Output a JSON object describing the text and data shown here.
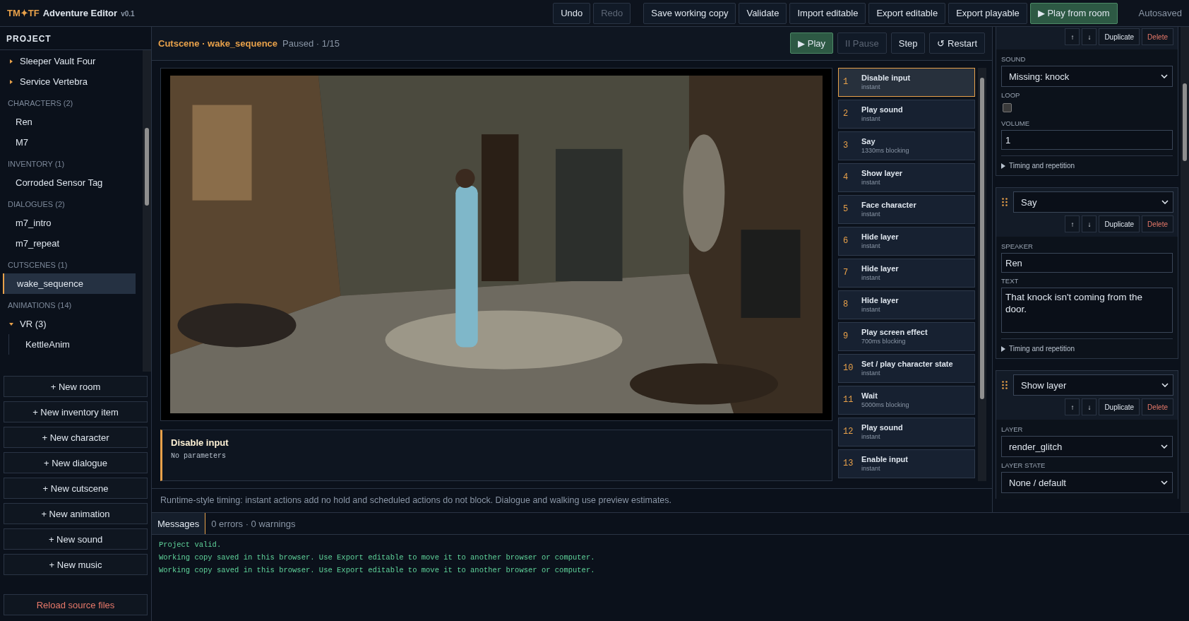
{
  "app": {
    "brand": "TM✦TF",
    "title": "Adventure Editor",
    "version": "v0.1",
    "status": "Autosaved"
  },
  "toolbar": [
    [
      {
        "label": "Undo",
        "kind": "plain",
        "disabled": false
      },
      {
        "label": "Redo",
        "kind": "plain",
        "disabled": true
      }
    ],
    [
      {
        "label": "Save working copy",
        "kind": "plain",
        "disabled": false
      },
      {
        "label": "Validate",
        "kind": "plain",
        "disabled": false
      },
      {
        "label": "Import editable",
        "kind": "plain",
        "disabled": false
      },
      {
        "label": "Export editable",
        "kind": "plain",
        "disabled": false
      },
      {
        "label": "Export playable",
        "kind": "plain",
        "disabled": false
      },
      {
        "label": "▶ Play from room",
        "kind": "primary",
        "disabled": false
      }
    ]
  ],
  "sidebar": {
    "heading": "PROJECT",
    "sections": [
      {
        "items": [
          {
            "label": "Sleeper Vault Four",
            "expanded": false,
            "selected": false
          },
          {
            "label": "Service Vertebra",
            "expanded": false,
            "selected": false
          }
        ]
      },
      {
        "heading": "CHARACTERS (2)",
        "items": [
          {
            "label": "Ren",
            "selected": false
          },
          {
            "label": "M7",
            "selected": false
          }
        ]
      },
      {
        "heading": "INVENTORY (1)",
        "items": [
          {
            "label": "Corroded Sensor Tag",
            "selected": false
          }
        ]
      },
      {
        "heading": "DIALOGUES (2)",
        "items": [
          {
            "label": "m7_intro",
            "selected": false
          },
          {
            "label": "m7_repeat",
            "selected": false
          }
        ]
      },
      {
        "heading": "CUTSCENES (1)",
        "items": [
          {
            "label": "wake_sequence",
            "selected": true
          }
        ]
      },
      {
        "heading": "ANIMATIONS (14)",
        "items": [
          {
            "label": "VR (3)",
            "expanded": true,
            "selected": false,
            "children": [
              {
                "label": "KettleAnim",
                "selected": false
              }
            ]
          }
        ]
      }
    ],
    "buttons": [
      "+ New room",
      "+ New inventory item",
      "+ New character",
      "+ New dialogue",
      "+ New cutscene",
      "+ New animation",
      "+ New sound",
      "+ New music"
    ],
    "reload": "Reload source files"
  },
  "cutscene": {
    "title": "Cutscene · wake_sequence",
    "status": "Paused · 1/15",
    "controls": [
      {
        "label": "▶ Play",
        "kind": "primary",
        "disabled": false
      },
      {
        "label": "II Pause",
        "kind": "plain",
        "disabled": true
      },
      {
        "label": "Step",
        "kind": "plain",
        "disabled": false
      },
      {
        "label": "↺ Restart",
        "kind": "plain",
        "disabled": false
      }
    ],
    "actions": [
      {
        "number": "1",
        "name": "Disable input",
        "timing": "instant",
        "selected": true
      },
      {
        "number": "2",
        "name": "Play sound",
        "timing": "instant",
        "selected": false
      },
      {
        "number": "3",
        "name": "Say",
        "timing": "1330ms blocking",
        "selected": false
      },
      {
        "number": "4",
        "name": "Show layer",
        "timing": "instant",
        "selected": false
      },
      {
        "number": "5",
        "name": "Face character",
        "timing": "instant",
        "selected": false
      },
      {
        "number": "6",
        "name": "Hide layer",
        "timing": "instant",
        "selected": false
      },
      {
        "number": "7",
        "name": "Hide layer",
        "timing": "instant",
        "selected": false
      },
      {
        "number": "8",
        "name": "Hide layer",
        "timing": "instant",
        "selected": false
      },
      {
        "number": "9",
        "name": "Play screen effect",
        "timing": "700ms blocking",
        "selected": false
      },
      {
        "number": "10",
        "name": "Set / play character state",
        "timing": "instant",
        "selected": false
      },
      {
        "number": "11",
        "name": "Wait",
        "timing": "5000ms blocking",
        "selected": false
      },
      {
        "number": "12",
        "name": "Play sound",
        "timing": "instant",
        "selected": false
      },
      {
        "number": "13",
        "name": "Enable input",
        "timing": "instant",
        "selected": false
      }
    ],
    "detail": {
      "title": "Disable input",
      "body": "No parameters"
    },
    "note": "Runtime-style timing: instant actions add no hold and scheduled actions do not block. Dialogue and walking use preview estimates."
  },
  "inspector": {
    "cards": [
      {
        "buttons": [
          "↑",
          "↓",
          "Duplicate",
          "Delete"
        ],
        "fields": [
          {
            "label": "SOUND",
            "kind": "select",
            "value": "Missing: knock"
          },
          {
            "label": "LOOP",
            "kind": "checkbox",
            "checked": false
          },
          {
            "label": "VOLUME",
            "kind": "input",
            "value": "1"
          }
        ],
        "disclosure": "Timing and repetition"
      },
      {
        "type": "Say",
        "buttons": [
          "↑",
          "↓",
          "Duplicate",
          "Delete"
        ],
        "fields": [
          {
            "label": "SPEAKER",
            "kind": "input",
            "value": "Ren"
          },
          {
            "label": "TEXT",
            "kind": "textarea",
            "value": "That knock isn't coming from the door."
          }
        ],
        "disclosure": "Timing and repetition"
      },
      {
        "type": "Show layer",
        "buttons": [
          "↑",
          "↓",
          "Duplicate",
          "Delete"
        ],
        "fields": [
          {
            "label": "LAYER",
            "kind": "select",
            "value": "render_glitch"
          },
          {
            "label": "LAYER STATE",
            "kind": "select",
            "value": "None / default"
          }
        ]
      }
    ]
  },
  "messages": {
    "tab": {
      "label": "Messages",
      "selected": true
    },
    "summary": "0 errors · 0 warnings",
    "lines": [
      "Project valid.",
      "Working copy saved in this browser. Use Export editable to move it to another browser or computer.",
      "Working copy saved in this browser. Use Export editable to move it to another browser or computer."
    ]
  }
}
